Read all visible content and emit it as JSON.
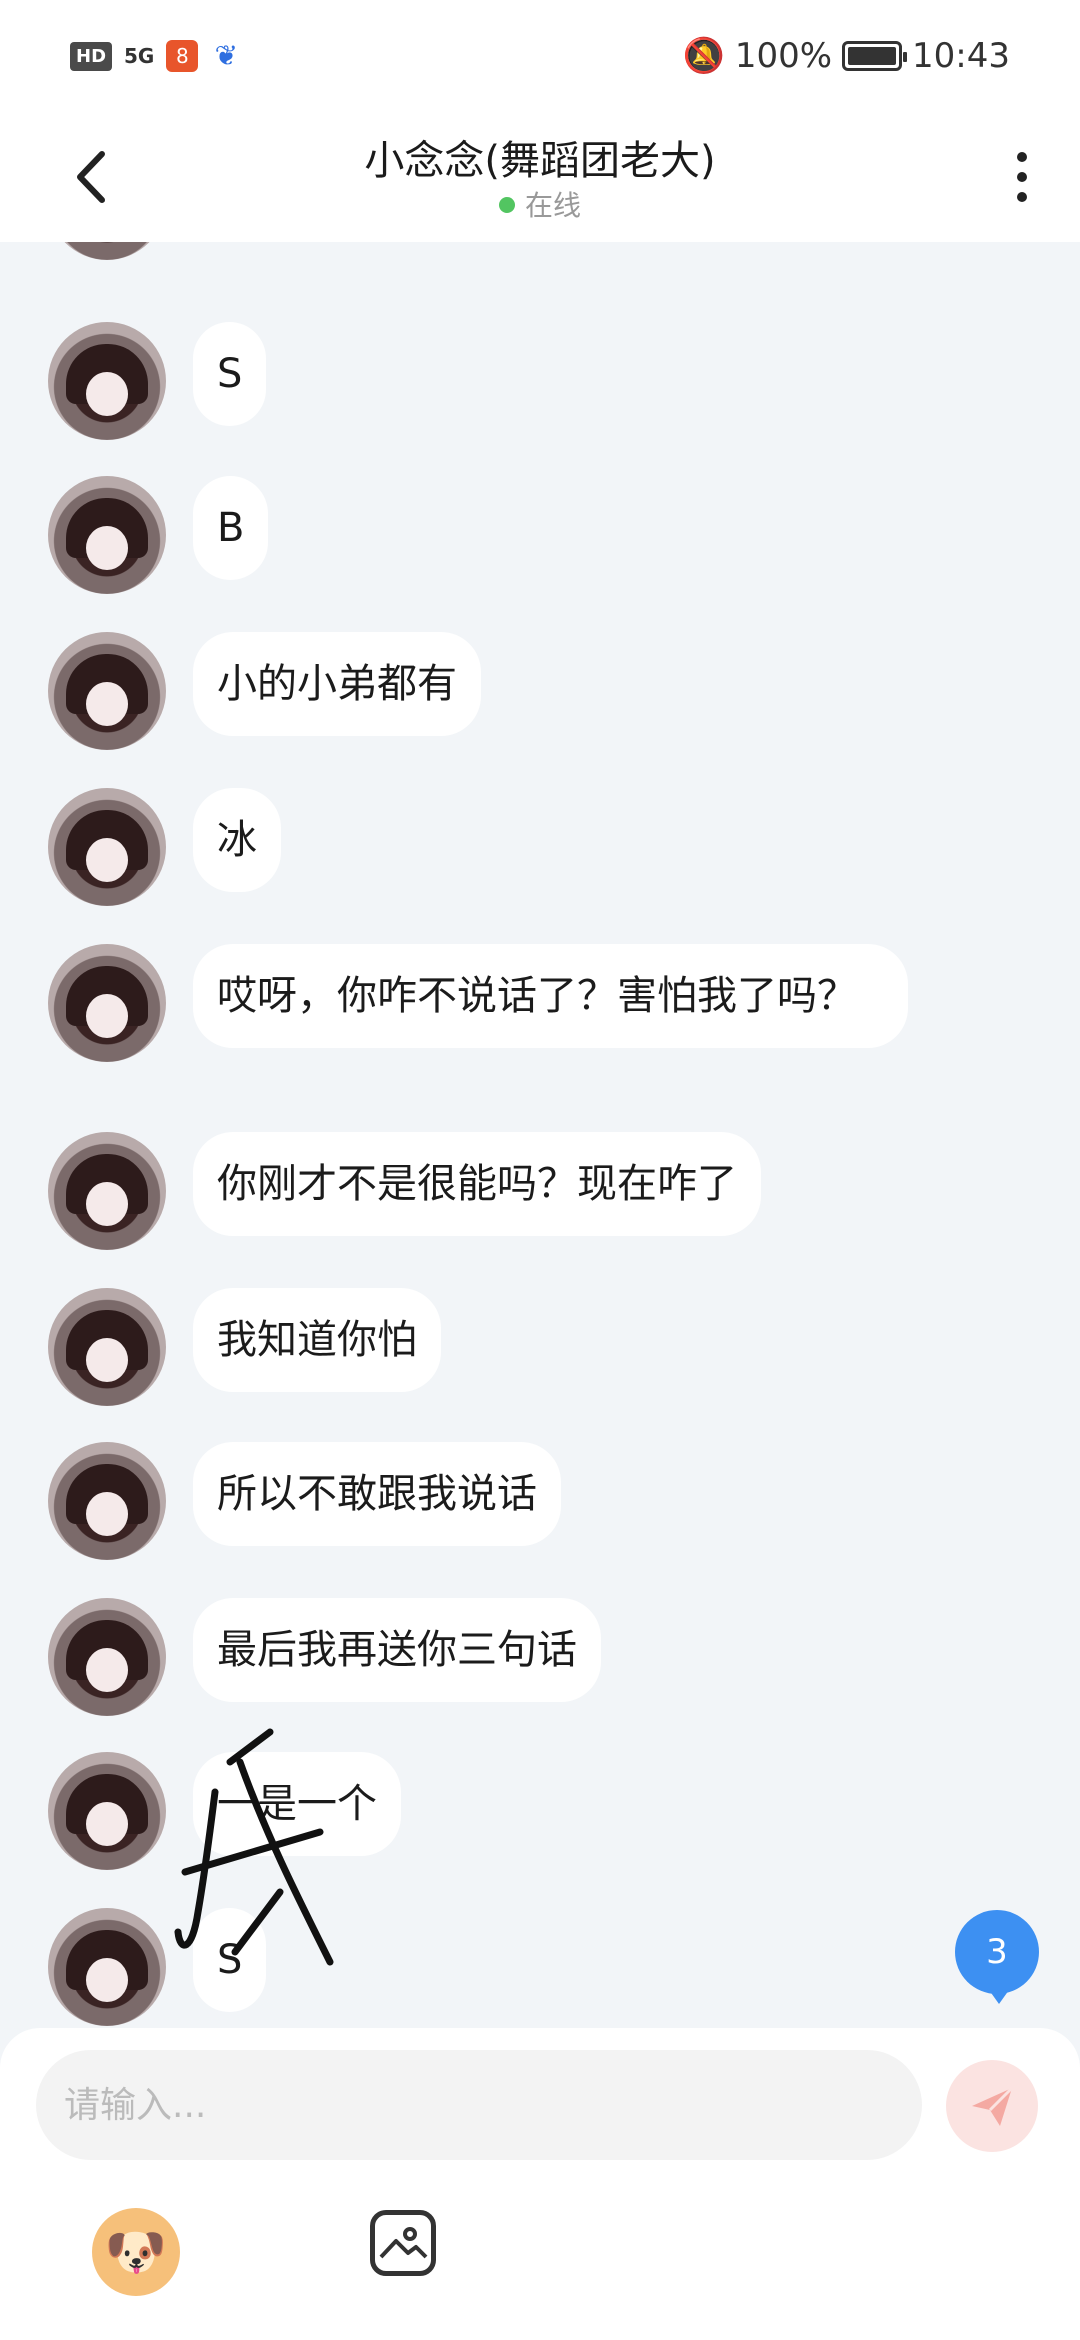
{
  "statusbar": {
    "hd": "HD",
    "signal": "5G",
    "battery_pct": "100%",
    "time": "10:43"
  },
  "header": {
    "back_icon": "chevron-left-icon",
    "title": "小念念(舞蹈团老大)",
    "status": "在线",
    "status_color": "#52c561",
    "more_icon": "more-vertical-icon"
  },
  "messages": [
    {
      "text": "S"
    },
    {
      "text": "B"
    },
    {
      "text": "小的小弟都有"
    },
    {
      "text": "冰"
    },
    {
      "text": "哎呀，你咋不说话了？害怕我了吗？"
    },
    {
      "text": "你刚才不是很能吗？现在咋了"
    },
    {
      "text": "我知道你怕"
    },
    {
      "text": "所以不敢跟我说话"
    },
    {
      "text": "最后我再送你三句话"
    },
    {
      "text": "一是一个"
    },
    {
      "text": "S"
    }
  ],
  "handwriting": "我",
  "unread_badge": "3",
  "input": {
    "placeholder": "请输入..."
  },
  "toolbar": {
    "emoji_icon": "avatar-emoji-icon",
    "image_icon": "image-icon",
    "send_icon": "send-icon"
  }
}
